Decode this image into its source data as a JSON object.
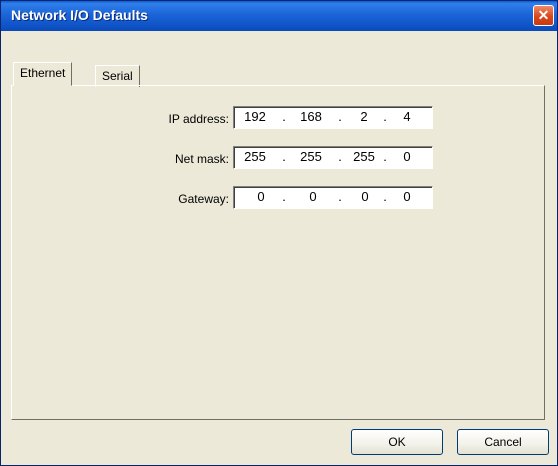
{
  "window": {
    "title": "Network I/O Defaults",
    "close_glyph": "✕"
  },
  "tabs": [
    {
      "label": "Ethernet"
    },
    {
      "label": "Serial"
    }
  ],
  "fields": [
    {
      "label": "IP address:",
      "octets": [
        "192",
        "168",
        "2",
        "4"
      ]
    },
    {
      "label": "Net mask:",
      "octets": [
        "255",
        "255",
        "255",
        "0"
      ]
    },
    {
      "label": "Gateway:",
      "octets": [
        "0",
        "0",
        "0",
        "0"
      ]
    }
  ],
  "separator": ".",
  "buttons": {
    "ok": "OK",
    "cancel": "Cancel"
  },
  "colors": {
    "titlebar": "#0a5ad8",
    "dialog_bg": "#ece9d8",
    "close": "#d9481b"
  }
}
